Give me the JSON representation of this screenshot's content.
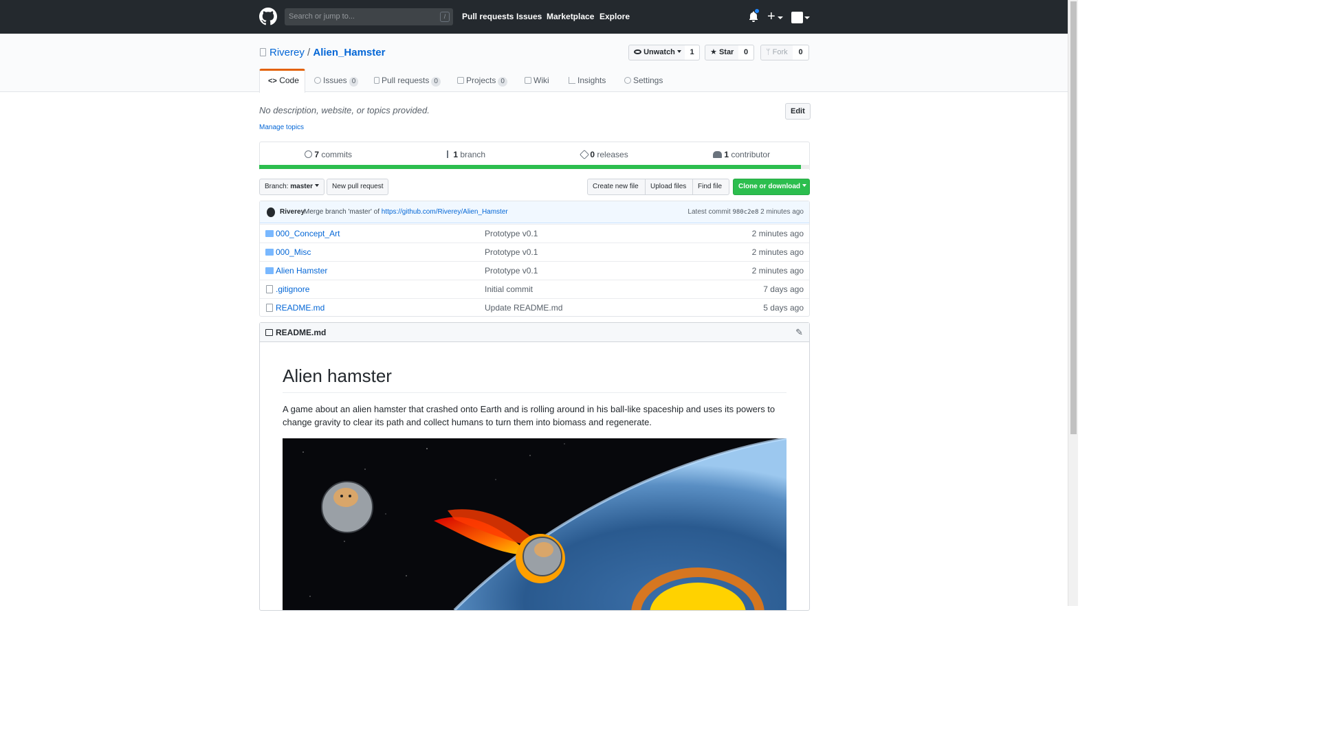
{
  "nav": {
    "search_placeholder": "Search or jump to...",
    "slash": "/",
    "links": [
      "Pull requests",
      "Issues",
      "Marketplace",
      "Explore"
    ],
    "plus": "+"
  },
  "repo": {
    "owner": "Riverey",
    "sep": "/",
    "name": "Alien_Hamster",
    "unwatch_label": "Unwatch",
    "watch_count": "1",
    "star_label": "Star",
    "star_count": "0",
    "fork_label": "Fork",
    "fork_count": "0"
  },
  "tabs": [
    {
      "label": "Code",
      "icon": "code-icon"
    },
    {
      "label": "Issues",
      "count": "0",
      "icon": "issue-icon"
    },
    {
      "label": "Pull requests",
      "count": "0",
      "icon": "pull-request-icon"
    },
    {
      "label": "Projects",
      "count": "0",
      "icon": "project-icon"
    },
    {
      "label": "Wiki",
      "icon": "book-icon"
    },
    {
      "label": "Insights",
      "icon": "graph-icon"
    },
    {
      "label": "Settings",
      "icon": "gear-icon"
    }
  ],
  "description": "No description, website, or topics provided.",
  "edit_label": "Edit",
  "manage_topics": "Manage topics",
  "summary": {
    "commits": {
      "count": "7",
      "label": "commits"
    },
    "branch": {
      "count": "1",
      "label": "branch"
    },
    "releases": {
      "count": "0",
      "label": "releases"
    },
    "contributors": {
      "count": "1",
      "label": "contributor"
    }
  },
  "language_bar": {
    "fill": 0.984
  },
  "toolbar": {
    "branch_prefix": "Branch:",
    "branch_name": "master",
    "new_pr": "New pull request",
    "create_file": "Create new file",
    "upload": "Upload files",
    "find": "Find file",
    "clone": "Clone or download"
  },
  "commit": {
    "author": "Riverey",
    "message": "Merge branch 'master' of",
    "link": "https://github.com/Riverey/Alien_Hamster",
    "latest_label": "Latest commit",
    "sha": "980c2e8",
    "time": "2 minutes ago"
  },
  "files": [
    {
      "name": "000_Concept_Art",
      "type": "dir",
      "message": "Prototype v0.1",
      "age": "2 minutes ago"
    },
    {
      "name": "000_Misc",
      "type": "dir",
      "message": "Prototype v0.1",
      "age": "2 minutes ago"
    },
    {
      "name": "Alien Hamster",
      "type": "dir",
      "message": "Prototype v0.1",
      "age": "2 minutes ago"
    },
    {
      "name": ".gitignore",
      "type": "file",
      "message": "Initial commit",
      "age": "7 days ago"
    },
    {
      "name": "README.md",
      "type": "file",
      "message": "Update README.md",
      "age": "5 days ago"
    }
  ],
  "readme": {
    "filename": "README.md",
    "title": "Alien hamster",
    "paragraph": "A game about an alien hamster that crashed onto Earth and is rolling around in his ball-like spaceship and uses its powers to change gravity to clear its path and collect humans to turn them into biomass and regenerate."
  },
  "colors": {
    "header": "#24292e",
    "link": "#0366d6",
    "clone_green": "#28a745",
    "lang_bar": "#2cbe4e",
    "tab_accent": "#e36209"
  }
}
